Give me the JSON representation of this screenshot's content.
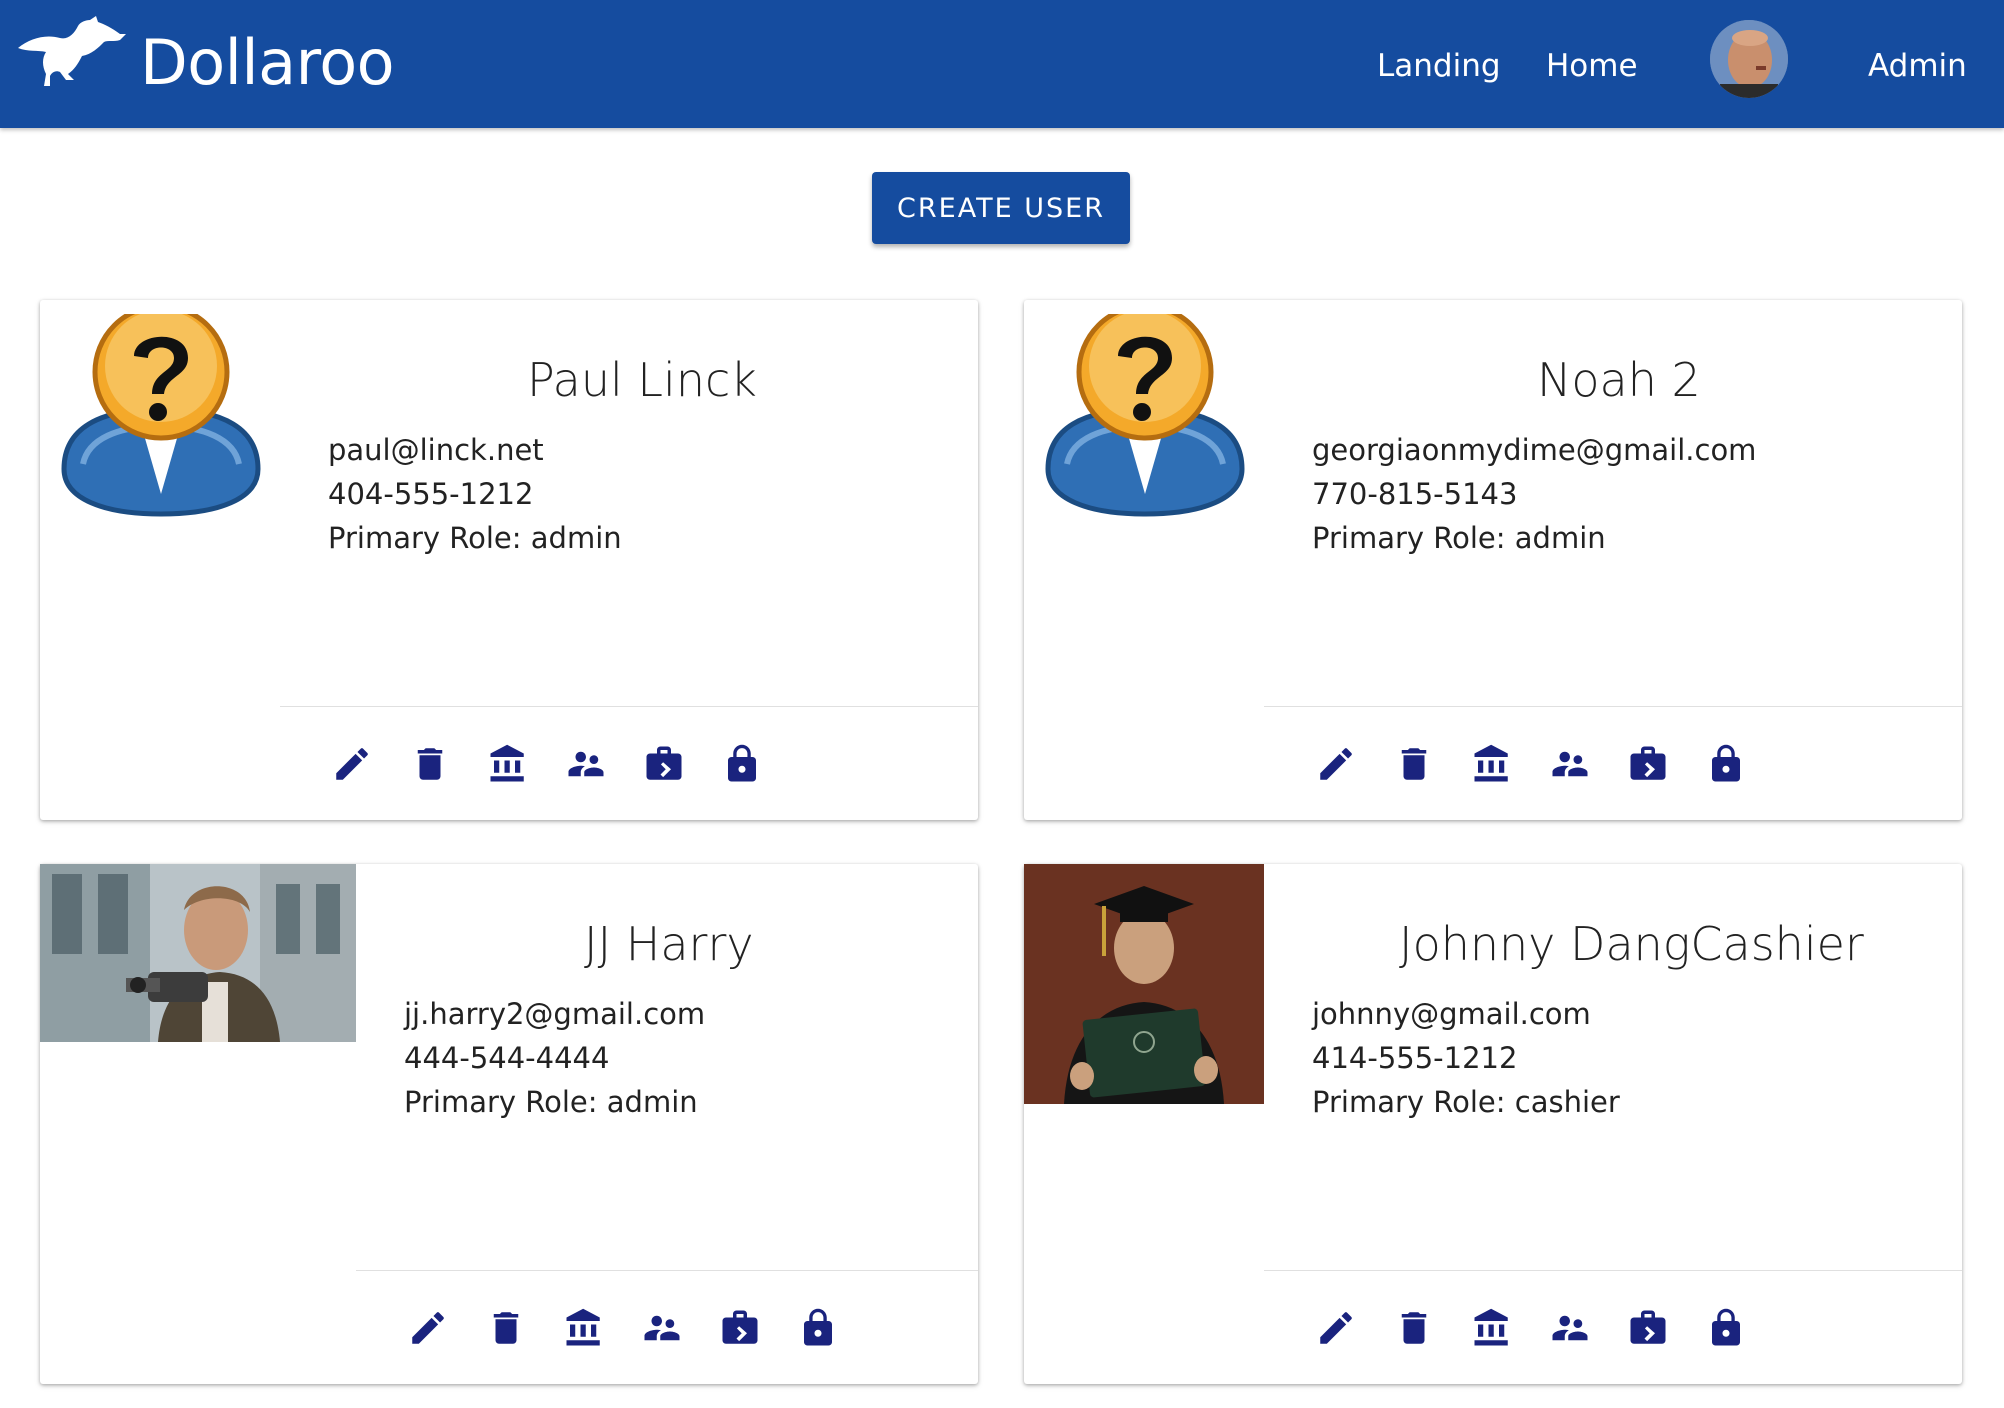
{
  "app": {
    "brand": "Dollaroo"
  },
  "nav": {
    "landing": "Landing",
    "home": "Home",
    "admin": "Admin"
  },
  "toolbar": {
    "create_user": "CREATE USER"
  },
  "colors": {
    "primary": "#154c9f",
    "icon": "#1a237e"
  },
  "users": [
    {
      "name": "Paul Linck",
      "email": "paul@linck.net",
      "phone": "404-555-1212",
      "role": "Primary Role: admin",
      "avatar": "unknown-user-icon"
    },
    {
      "name": "Noah 2",
      "email": "georgiaonmydime@gmail.com",
      "phone": "770-815-5143",
      "role": "Primary Role: admin",
      "avatar": "unknown-user-icon"
    },
    {
      "name": "JJ Harry",
      "email": "jj.harry2@gmail.com",
      "phone": "444-544-4444",
      "role": "Primary Role: admin",
      "avatar": "photo"
    },
    {
      "name": "Johnny DangCashier",
      "email": "johnny@gmail.com",
      "phone": "414-555-1212",
      "role": "Primary Role: cashier",
      "avatar": "photo"
    }
  ],
  "card_actions": [
    "edit-icon",
    "delete-icon",
    "bank-icon",
    "people-icon",
    "work-icon",
    "lock-icon"
  ]
}
